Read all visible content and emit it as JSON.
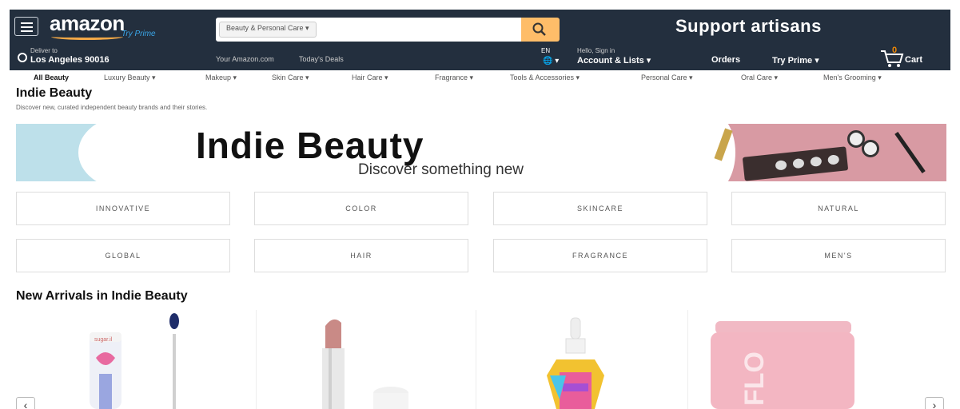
{
  "header": {
    "logo": "amazon",
    "logo_sub": "Try Prime",
    "search_category": "Beauty & Personal Care ▾",
    "search_placeholder": "",
    "promo": "Support artisans",
    "deliver_line1": "Deliver to",
    "deliver_line2": "Los Angeles 90016",
    "your_amazon": "Your Amazon.com",
    "todays_deals": "Today's Deals",
    "lang": "EN",
    "globe": "🌐 ▾",
    "account_line1": "Hello, Sign in",
    "account_line2": "Account & Lists ▾",
    "orders": "Orders",
    "try_prime": "Try Prime ▾",
    "cart_count": "0",
    "cart_label": "Cart"
  },
  "subnav": [
    "All Beauty",
    "Luxury Beauty ▾",
    "Makeup ▾",
    "Skin Care ▾",
    "Hair Care ▾",
    "Fragrance ▾",
    "Tools & Accessories ▾",
    "Personal Care ▾",
    "Oral Care ▾",
    "Men's Grooming ▾"
  ],
  "page": {
    "title": "Indie Beauty",
    "description": "Discover new, curated independent beauty brands and their stories."
  },
  "hero": {
    "title": "Indie Beauty",
    "subtitle": "Discover something new"
  },
  "categories": [
    "INNOVATIVE",
    "COLOR",
    "SKINCARE",
    "NATURAL",
    "GLOBAL",
    "HAIR",
    "FRAGRANCE",
    "MEN'S"
  ],
  "new_arrivals": {
    "title": "New Arrivals in Indie Beauty",
    "prev": "‹",
    "next": "›",
    "product_texts": [
      "sugar.il",
      "FLO"
    ]
  },
  "colors": {
    "header_bg": "#232f3e",
    "search_btn": "#febd69",
    "hero_blue": "#bde0ea",
    "hero_pink": "#d89aa3"
  }
}
